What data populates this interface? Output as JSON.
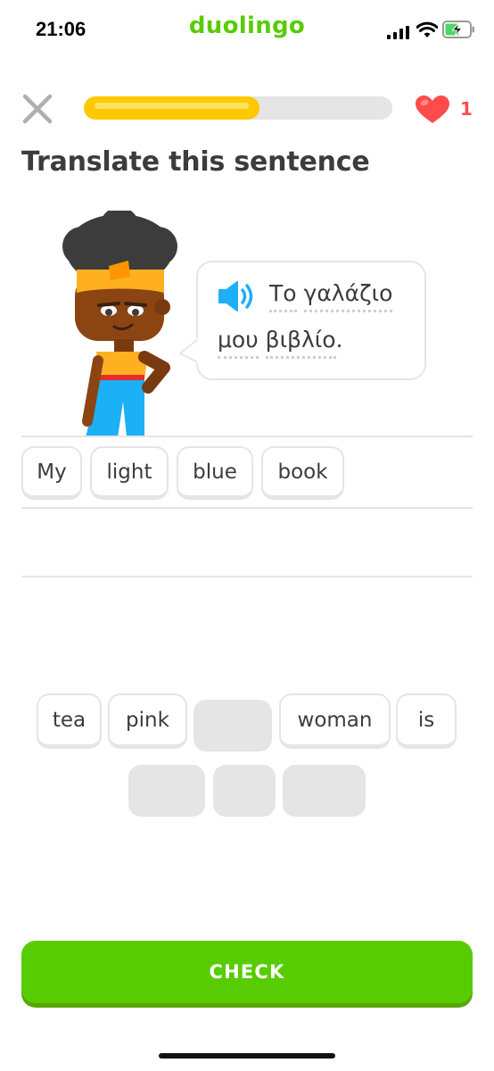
{
  "status_bar": {
    "time": "21:06",
    "carrier": "duolingo",
    "icons": [
      "signal-icon",
      "wifi-icon",
      "battery-charging-icon"
    ]
  },
  "header": {
    "close_icon": "close-icon",
    "progress_fraction": 0.57,
    "hearts": {
      "icon": "heart-icon",
      "count": "1"
    }
  },
  "exercise": {
    "title": "Translate this sentence",
    "prompt": {
      "speaker_icon": "speaker-icon",
      "line1_word1": "Το",
      "line1_word2": "γαλάζιο",
      "line2_word1": "μου",
      "line2_word2": "βιβλίο",
      "line2_punct": "."
    },
    "answer_words": [
      "My",
      "light",
      "blue",
      "book"
    ]
  },
  "word_bank": {
    "row1": [
      "tea",
      "pink",
      "",
      "woman",
      "is"
    ],
    "row2": [
      "",
      "",
      ""
    ]
  },
  "check_button": {
    "label": "CHECK"
  },
  "colors": {
    "brand_green": "#58cc02",
    "progress_yellow": "#ffc800",
    "heart_red": "#ff4b4b",
    "speaker_blue": "#1cb0f6",
    "border_gray": "#e5e5e5"
  }
}
